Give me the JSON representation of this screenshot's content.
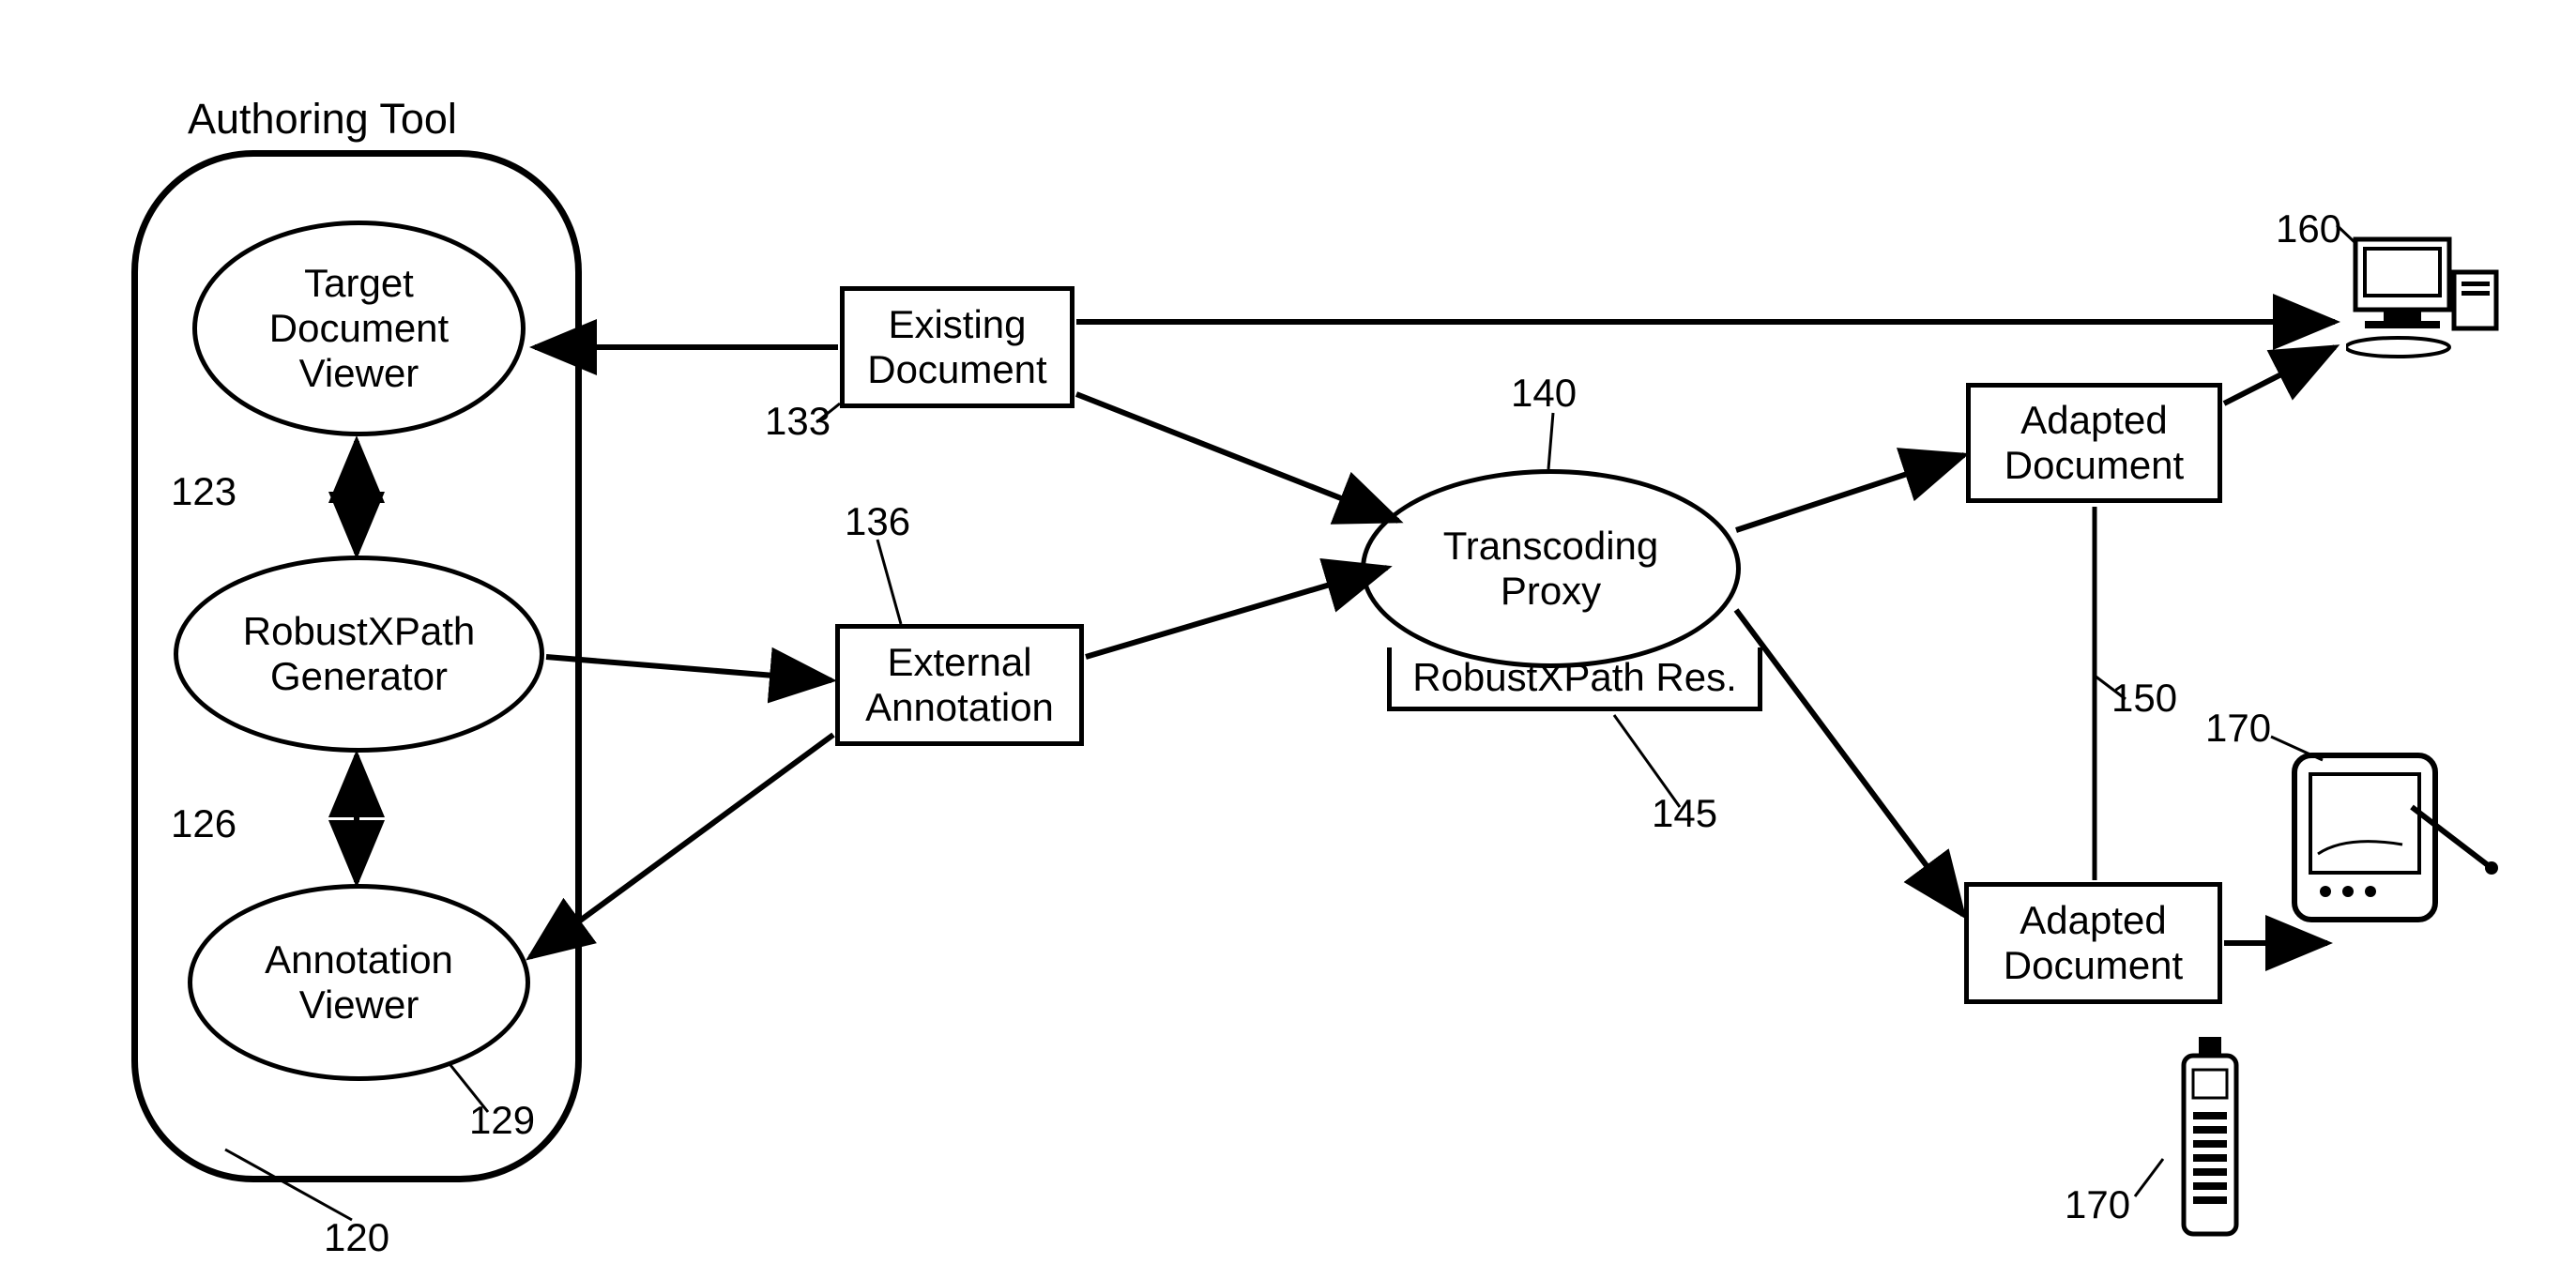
{
  "title": "Authoring Tool",
  "nodes": {
    "target_document_viewer": "Target\nDocument\nViewer",
    "robustxpath_generator": "RobustXPath\nGenerator",
    "annotation_viewer": "Annotation\nViewer",
    "existing_document": "Existing\nDocument",
    "external_annotation": "External\nAnnotation",
    "transcoding_proxy": "Transcoding\nProxy",
    "robustxpath_res": "RobustXPath Res.",
    "adapted_document_1": "Adapted\nDocument",
    "adapted_document_2": "Adapted\nDocument"
  },
  "refs": {
    "r120": "120",
    "r123": "123",
    "r126": "126",
    "r129": "129",
    "r133": "133",
    "r136": "136",
    "r140": "140",
    "r145": "145",
    "r150": "150",
    "r160": "160",
    "r170a": "170",
    "r170b": "170"
  }
}
